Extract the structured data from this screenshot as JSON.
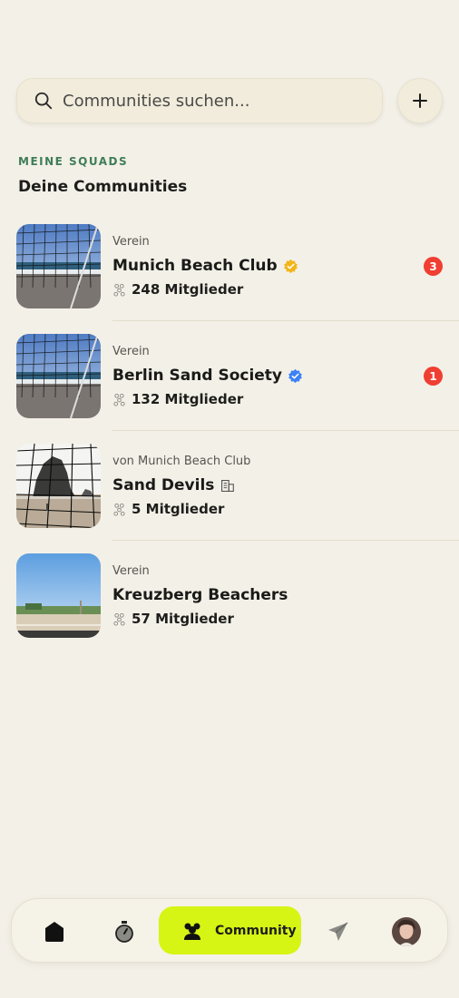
{
  "search": {
    "placeholder": "Communities suchen..."
  },
  "section": {
    "kicker": "MEINE SQUADS",
    "title": "Deine Communities"
  },
  "communities": [
    {
      "kind": "Verein",
      "name": "Munich Beach Club",
      "badge": "gold-verified-icon",
      "members": "248 Mitglieder",
      "unread": "3"
    },
    {
      "kind": "Verein",
      "name": "Berlin Sand Society",
      "badge": "blue-verified-icon",
      "members": "132 Mitglieder",
      "unread": "1"
    },
    {
      "kind": "von Munich Beach Club",
      "name": "Sand Devils",
      "badge": "building-icon",
      "members": "5 Mitglieder",
      "unread": ""
    },
    {
      "kind": "Verein",
      "name": "Kreuzberg Beachers",
      "badge": "",
      "members": "57 Mitglieder",
      "unread": ""
    }
  ],
  "nav": {
    "active_label": "Community"
  },
  "colors": {
    "accent": "#d6f514",
    "kicker": "#3f7d58",
    "unread": "#f03e32",
    "gold": "#f2b51a",
    "blue": "#3b82f6"
  }
}
